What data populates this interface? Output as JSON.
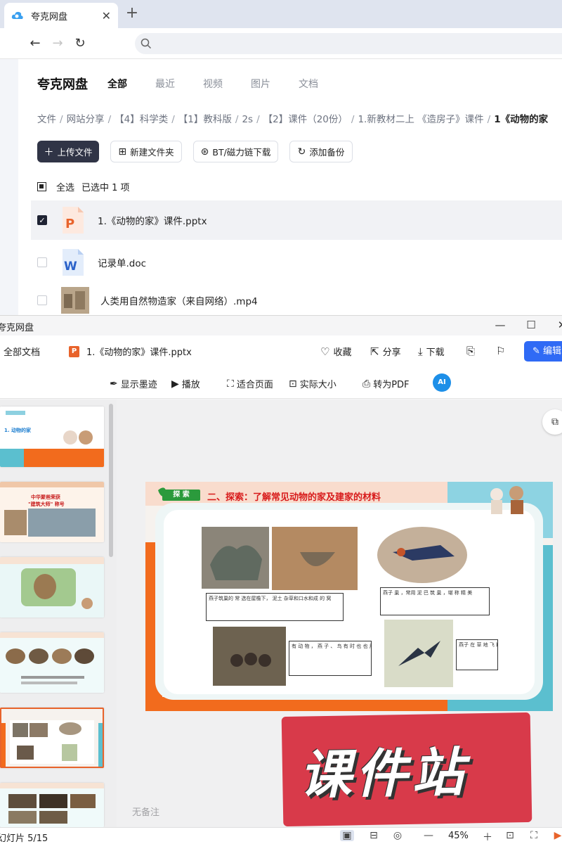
{
  "browser": {
    "tab_title": "夸克网盘",
    "tab_close": "✕",
    "new_tab": "+",
    "back": "←",
    "forward": "→",
    "reload": "↻"
  },
  "drive": {
    "brand": "夸克网盘",
    "tabs": [
      "全部",
      "最近",
      "视频",
      "图片",
      "文档"
    ],
    "breadcrumb": [
      "文件",
      "网站分享",
      "【4】科学类",
      "【1】教科版",
      "2s",
      "【2】课件（20份）",
      "1.新教材二上 《造房子》课件",
      "1《动物的家"
    ],
    "toolbar": {
      "upload": "上传文件",
      "new_folder": "新建文件夹",
      "bt": "BT/磁力链下载",
      "backup": "添加备份"
    },
    "select_all": "全选",
    "selected_text": "已选中 1 项",
    "files": [
      {
        "name": "1.《动物的家》课件.pptx",
        "type": "pptx",
        "checked": true
      },
      {
        "name": "记录单.doc",
        "type": "doc",
        "checked": false
      },
      {
        "name": "人类用自然物造家（来自网络）.mp4",
        "type": "mp4",
        "checked": false
      }
    ]
  },
  "viewer": {
    "window_title": "夸克网盘",
    "win_min": "—",
    "win_max": "☐",
    "win_close": "✕",
    "all_docs": "全部文档",
    "file_title": "1.《动物的家》课件.pptx",
    "actions": {
      "favorite": "收藏",
      "share": "分享",
      "download": "下载",
      "edit": "编辑"
    },
    "tools": {
      "ink": "显示墨迹",
      "play": "播放",
      "fit": "适合页面",
      "actual": "实际大小",
      "to_pdf": "转为PDF",
      "ai": "AI"
    },
    "notes": "无备注",
    "status_slide": "幻灯片 5/15",
    "zoom": "45%",
    "selected_thumb": 5
  },
  "slide": {
    "badge": "探 索",
    "title": "二、探索：了解常见动物的家及建家的材料",
    "captions": [
      "燕子筑巢的 常 选在屋檐下， 泥土 杂草和口水和成 的 窝",
      "燕子 巢 ，常用 泥 巴 筑 巢 ，堪 称 精 美",
      "有 动 物 ， 燕 子 、 鸟 有 时 也 也 用 树 枝 与 泥 土 ",
      "燕子 在 草 地 飞 翔"
    ]
  },
  "watermark": "课件站",
  "colors": {
    "accent_orange": "#e8632b",
    "edit_blue": "#2f6af5",
    "upload_dark": "#303446",
    "watermark_red": "#d83a4a",
    "title_red": "#d81b1b",
    "explore_green": "#2b9a3c"
  }
}
